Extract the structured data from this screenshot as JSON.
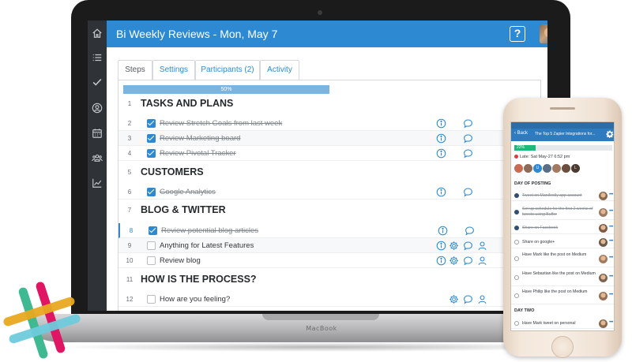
{
  "colors": {
    "brand_blue": "#2d8ad2",
    "sidebar_dark": "#2f3237",
    "progress_light": "#7ab4e0",
    "mobile_green": "#1cb97a",
    "late_red": "#e0393e"
  },
  "laptop": {
    "brand": "MacBook"
  },
  "app": {
    "title": "Bi Weekly Reviews - Mon, May 7",
    "help_label": "?",
    "sidebar_icons": [
      "home-icon",
      "list-icon",
      "check-icon",
      "user-icon",
      "calendar-icon",
      "team-icon",
      "chart-icon"
    ],
    "tabs": [
      {
        "label": "Steps"
      },
      {
        "label": "Settings"
      },
      {
        "label": "Participants (2)"
      },
      {
        "label": "Activity"
      }
    ],
    "progress": {
      "label": "50%",
      "value": 50
    },
    "rows": [
      {
        "type": "section",
        "num": "1",
        "title": "TASKS AND PLANS"
      },
      {
        "type": "task",
        "num": "2",
        "label": "Review Stretch Goals from last week",
        "done": true
      },
      {
        "type": "task",
        "num": "3",
        "label": "Review Marketing board",
        "done": true
      },
      {
        "type": "task",
        "num": "4",
        "label": "Review Pivotal Tracker",
        "done": true
      },
      {
        "type": "section",
        "num": "5",
        "title": "CUSTOMERS"
      },
      {
        "type": "task",
        "num": "6",
        "label": "Google Analytics",
        "done": true
      },
      {
        "type": "section",
        "num": "7",
        "title": "BLOG & TWITTER"
      },
      {
        "type": "task",
        "num": "8",
        "label": "Review potential blog articles",
        "done": true
      },
      {
        "type": "task",
        "num": "9",
        "label": "Anything for Latest Features",
        "done": false
      },
      {
        "type": "task",
        "num": "10",
        "label": "Review blog",
        "done": false
      },
      {
        "type": "section",
        "num": "11",
        "title": "HOW IS THE PROCESS?"
      },
      {
        "type": "task",
        "num": "12",
        "label": "How are you feeling?",
        "done": false
      }
    ]
  },
  "mobile": {
    "back_label": "Back",
    "title": "The Top 5 Zapier Integrations for...",
    "progress": {
      "label": "22%",
      "value": 22
    },
    "late_label": "Late: Sat May-27 6:52 pm",
    "avatar_letters": [
      "",
      "",
      "U",
      "",
      "",
      "",
      "L"
    ],
    "sections": [
      "DAY OF POSTING",
      "DAY TWO"
    ],
    "items": [
      {
        "text": "Tweet on Manifestly app account",
        "done": true
      },
      {
        "text": "Set up schedule for the first 2 weeks of tweets using Buffer",
        "done": true
      },
      {
        "text": "Share on Facebook",
        "done": true
      },
      {
        "text": "Share on google+",
        "done": false
      },
      {
        "text": "Have Mark like the post on Medium",
        "done": false
      },
      {
        "text": "Have Sebastian like the post on Medium",
        "done": false
      },
      {
        "text": "Have Philip like the post on Medium",
        "done": false
      },
      {
        "text": "Have Mark tweet on personal",
        "done": false
      }
    ],
    "more_label": "•••"
  },
  "logo": {
    "name": "slack-logo",
    "colors": [
      "#e01563",
      "#3eb991",
      "#6ecadc",
      "#e9a820"
    ]
  }
}
